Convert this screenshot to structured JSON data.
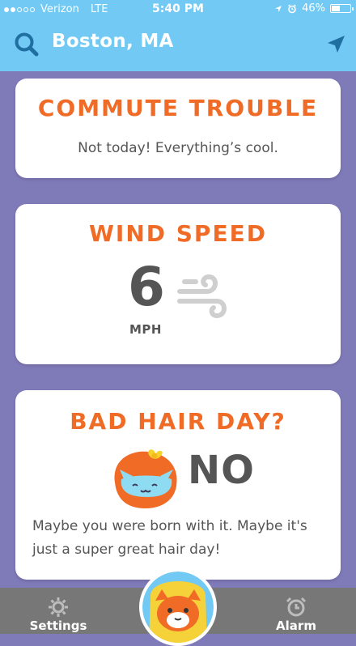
{
  "status_bar": {
    "carrier": "Verizon",
    "network": "LTE",
    "time": "5:40 PM",
    "battery": "46%",
    "battery_level": 0.46,
    "signal_bars_filled": 2,
    "signal_bars_total": 5
  },
  "header": {
    "location": "Boston, MA",
    "search_icon": "search-icon",
    "location_icon": "location-arrow-icon"
  },
  "commute_card": {
    "title": "COMMUTE TROUBLE",
    "message": "Not today! Everything’s cool."
  },
  "wind_card": {
    "title": "WIND SPEED",
    "value": "6",
    "unit": "MPH",
    "icon": "wind-icon"
  },
  "hair_card": {
    "title": "BAD HAIR DAY?",
    "answer": "NO",
    "message": "Maybe you were born with it. Maybe it's just a super great hair day!",
    "icon": "cat-headscarf-icon"
  },
  "tabbar": {
    "settings_label": "Settings",
    "alarm_label": "Alarm",
    "center_icon": "cat-mascot-icon"
  },
  "colors": {
    "header_blue": "#71c9f4",
    "background_purple": "#7f7ab8",
    "accent_orange": "#f06b26",
    "tabbar_gray": "#777777",
    "text_gray": "#555555"
  }
}
